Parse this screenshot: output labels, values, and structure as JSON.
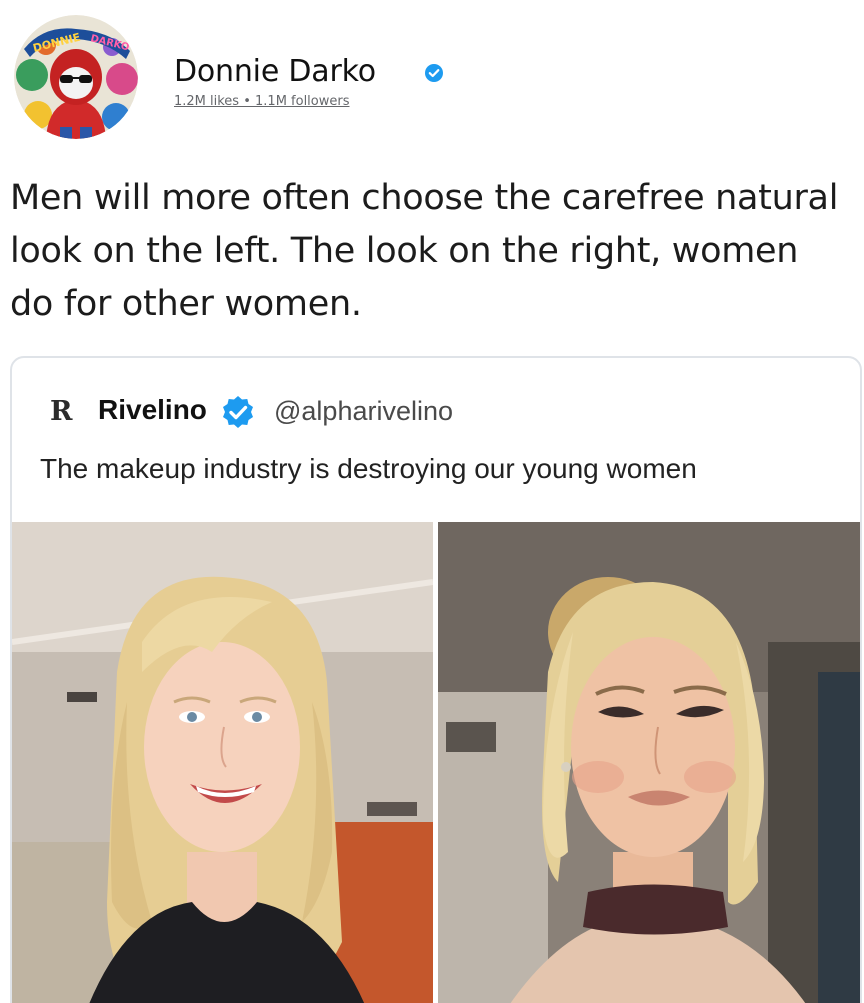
{
  "post": {
    "author": {
      "name": "Donnie Darko",
      "verified": true,
      "stats": "1.2M likes • 1.1M followers",
      "avatar_icon": "cartoon-avatar-icon",
      "avatar_logo_text": "DONNIE DARKO"
    },
    "text": "Men will more often choose the carefree natural look on the left. The look on the right, women do for other women."
  },
  "quoted_tweet": {
    "logo_glyph": "R",
    "name": "Rivelino",
    "verified": true,
    "handle": "@alpharivelino",
    "text": "The makeup industry is destroying our young women",
    "images": [
      {
        "side": "left",
        "subject": "photo-natural-look"
      },
      {
        "side": "right",
        "subject": "photo-makeup-look"
      }
    ]
  },
  "colors": {
    "verified_blue": "#1d9bf0",
    "card_border": "#dfe3e8",
    "stats_gray": "#65676b"
  }
}
